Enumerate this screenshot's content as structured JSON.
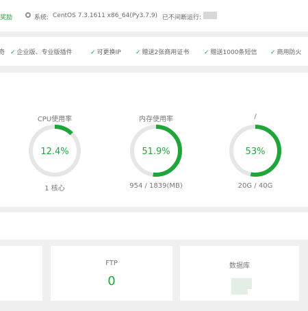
{
  "topbar": {
    "reward": "奖励",
    "system_label": "系统:",
    "system_value": "CentOS 7.3.1611 x86_64(Py3.7.9)",
    "uptime_label": "已不间断运行:"
  },
  "features": {
    "items": [
      {
        "label": "奇"
      },
      {
        "label": "企业版、专业版插件"
      },
      {
        "label": "可更换IP"
      },
      {
        "label": "赠送2张商用证书"
      },
      {
        "label": "赠送1000条短信"
      },
      {
        "label": "商用防火"
      }
    ]
  },
  "gauges": [
    {
      "title": "CPU使用率",
      "value": "12.4%",
      "percent": 12.4,
      "sub": "1 核心"
    },
    {
      "title": "内存使用率",
      "value": "51.9%",
      "percent": 51.9,
      "sub": "954 / 1839(MB)"
    },
    {
      "title": "/",
      "value": "53%",
      "percent": 53,
      "sub": "20G / 40G"
    }
  ],
  "tiles": {
    "ftp": {
      "label": "FTP",
      "value": "0"
    },
    "database": {
      "label": "数据库"
    }
  },
  "colors": {
    "accent": "#20a53a",
    "ring_bg": "#e6e6e6"
  }
}
